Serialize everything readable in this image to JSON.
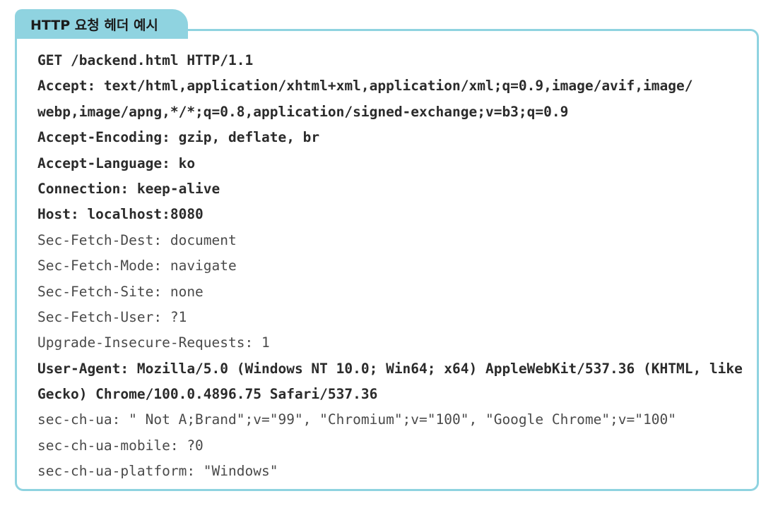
{
  "header": {
    "title": "HTTP 요청 헤더 예시"
  },
  "lines": [
    {
      "text": "GET /backend.html HTTP/1.1",
      "bold": true
    },
    {
      "text": "Accept: text/html,application/xhtml+xml,application/xml;q=0.9,image/avif,image/",
      "bold": true
    },
    {
      "text": "webp,image/apng,*/*;q=0.8,application/signed-exchange;v=b3;q=0.9",
      "bold": true
    },
    {
      "text": "Accept-Encoding: gzip, deflate, br",
      "bold": true
    },
    {
      "text": "Accept-Language: ko",
      "bold": true
    },
    {
      "text": "Connection: keep-alive",
      "bold": true
    },
    {
      "text": "Host: localhost:8080",
      "bold": true
    },
    {
      "text": "Sec-Fetch-Dest: document",
      "bold": false
    },
    {
      "text": "Sec-Fetch-Mode: navigate",
      "bold": false
    },
    {
      "text": "Sec-Fetch-Site: none",
      "bold": false
    },
    {
      "text": "Sec-Fetch-User: ?1",
      "bold": false
    },
    {
      "text": "Upgrade-Insecure-Requests: 1",
      "bold": false
    },
    {
      "text": "User-Agent: Mozilla/5.0 (Windows NT 10.0; Win64; x64) AppleWebKit/537.36 (KHTML, like",
      "bold": true
    },
    {
      "text": "Gecko) Chrome/100.0.4896.75 Safari/537.36",
      "bold": true
    },
    {
      "text": "sec-ch-ua: \" Not A;Brand\";v=\"99\", \"Chromium\";v=\"100\", \"Google Chrome\";v=\"100\"",
      "bold": false
    },
    {
      "text": "sec-ch-ua-mobile: ?0",
      "bold": false
    },
    {
      "text": "sec-ch-ua-platform: \"Windows\"",
      "bold": false
    }
  ],
  "colors": {
    "accent": "#8fd3e0",
    "text": "#2b2b2b"
  }
}
